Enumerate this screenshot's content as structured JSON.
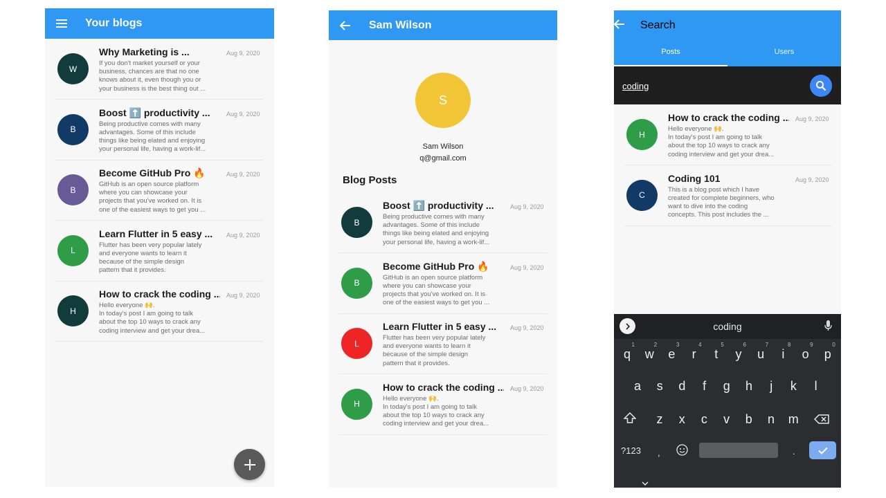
{
  "screen1": {
    "title": "Your blogs",
    "menu_icon": "menu-icon",
    "fab_icon": "plus-icon",
    "posts": [
      {
        "initial": "W",
        "color": "#123b3b",
        "title": "Why Marketing is ...",
        "body": "If you don't market yourself or your\nbusiness, chances are that no one\nknows about it, even though you or\nyour business is the best thing out ...",
        "date": "Aug 9, 2020"
      },
      {
        "initial": "B",
        "color": "#123a66",
        "title": "Boost ⬆️ productivity ...",
        "body": "Being productive comes with many\nadvantages. Some of this include\nthings like being elated and enjoying\nyour personal life, having a work-lif...",
        "date": "Aug 9, 2020"
      },
      {
        "initial": "B",
        "color": "#675a96",
        "title": "Become GitHub Pro 🔥",
        "body": "GitHub is an open source platform\nwhere you can showcase your\nprojects that you've worked on. It is\none of the easiest ways to get you ...",
        "date": "Aug 9, 2020"
      },
      {
        "initial": "L",
        "color": "#2f9d48",
        "title": "Learn Flutter in 5 easy ...",
        "body": "Flutter has been very popular lately\nand everyone wants to learn it\nbecause of the simple design\npattern that it provides.",
        "date": "Aug 9, 2020"
      },
      {
        "initial": "H",
        "color": "#123b3b",
        "title": "How to crack the coding ...",
        "body": "Hello everyone 🙌.\nIn today's post I am going to talk\nabout the top 10 ways to crack any\ncoding interview and get your drea...",
        "date": "Aug 9, 2020"
      }
    ]
  },
  "screen2": {
    "title": "Sam Wilson",
    "back_icon": "arrow-left-icon",
    "profile": {
      "initial": "S",
      "name": "Sam Wilson",
      "email": "q@gmail.com"
    },
    "section_title": "Blog Posts",
    "posts": [
      {
        "initial": "B",
        "color": "#123b3b",
        "title": "Boost ⬆️ productivity ...",
        "body": "Being productive comes with many\nadvantages. Some of this include\nthings like being elated and enjoying\nyour personal life, having a work-lif...",
        "date": "Aug 9, 2020"
      },
      {
        "initial": "B",
        "color": "#2f9d48",
        "title": "Become GitHub Pro 🔥",
        "body": "GitHub is an open source platform\nwhere you can showcase your\nprojects that you've worked on. It is\none of the easiest ways to get you ...",
        "date": "Aug 9, 2020"
      },
      {
        "initial": "L",
        "color": "#ee2525",
        "title": "Learn Flutter in 5 easy ...",
        "body": "Flutter has been very popular lately\nand everyone wants to learn it\nbecause of the simple design\npattern that it provides.",
        "date": "Aug 9, 2020"
      },
      {
        "initial": "H",
        "color": "#2f9d48",
        "title": "How to crack the coding ...",
        "body": "Hello everyone 🙌.\nIn today's post I am going to talk\nabout the top 10 ways to crack any\ncoding interview and get your drea...",
        "date": "Aug 9, 2020"
      }
    ]
  },
  "screen3": {
    "title": "Search",
    "back_icon": "arrow-left-icon",
    "tabs": [
      "Posts",
      "Users"
    ],
    "active_tab": "Posts",
    "search_value": "coding",
    "search_icon": "search-icon",
    "results": [
      {
        "initial": "H",
        "color": "#2f9d48",
        "title": "How to crack the coding ...",
        "body": "Hello everyone 🙌.\nIn today's post I am going to talk\nabout the top 10 ways to crack any\ncoding interview and get your drea...",
        "date": "Aug 9, 2020"
      },
      {
        "initial": "C",
        "color": "#123a66",
        "title": "Coding 101",
        "body": "This is a blog post which I have\ncreated for complete beginners, who\nwant to dive into the coding\nconcepts. This post includes the ...",
        "date": "Aug 9, 2020"
      }
    ],
    "keyboard": {
      "suggestion": "coding",
      "row1": [
        "q",
        "w",
        "e",
        "r",
        "t",
        "y",
        "u",
        "i",
        "o",
        "p"
      ],
      "row1_hints": [
        "1",
        "2",
        "3",
        "4",
        "5",
        "6",
        "7",
        "8",
        "9",
        "0"
      ],
      "row2": [
        "a",
        "s",
        "d",
        "f",
        "g",
        "h",
        "j",
        "k",
        "l"
      ],
      "row3": [
        "z",
        "x",
        "c",
        "v",
        "b",
        "n",
        "m"
      ],
      "symbols_label": "?123",
      "comma": ",",
      "period": "."
    }
  }
}
